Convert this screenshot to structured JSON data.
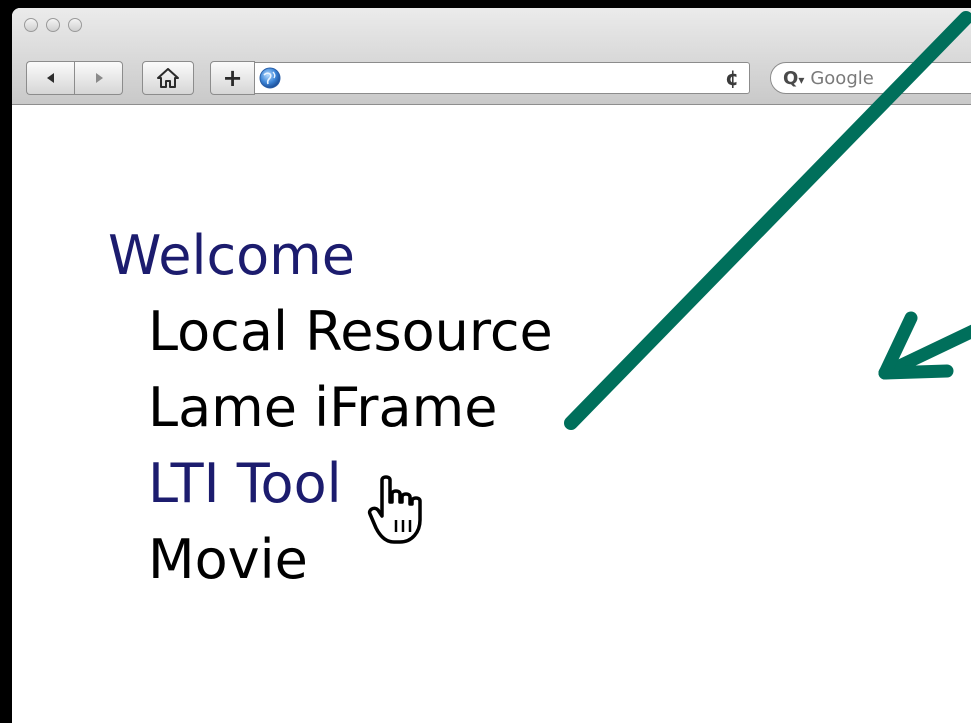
{
  "browser": {
    "window_controls": [
      "close",
      "minimize",
      "zoom"
    ],
    "toolbar": {
      "back_icon": "back-arrow-icon",
      "forward_icon": "forward-arrow-icon",
      "home_icon": "home-icon",
      "add_bookmark_label": "+",
      "site_icon": "globe-icon",
      "address": "",
      "reload_icon": "reload-icon",
      "reload_glyph": "¢"
    },
    "search": {
      "icon": "magnifier-dropdown-icon",
      "glyph": "Q",
      "caret": "▾",
      "placeholder": "Google"
    }
  },
  "content": {
    "nav": {
      "welcome": "Welcome",
      "items": [
        "Local Resource",
        "Lame iFrame",
        "LTI Tool",
        "Movie"
      ]
    }
  },
  "cursor": "pointing-hand-icon",
  "annotations": {
    "arrow_color": "#006f5b",
    "arrows": [
      "pointer-arrow-to-lame-iframe",
      "pointer-arrow-to-content-area"
    ]
  },
  "colors": {
    "link": "#1c1c6e",
    "text": "#000000",
    "background": "#000000",
    "arrow": "#006f5b"
  }
}
